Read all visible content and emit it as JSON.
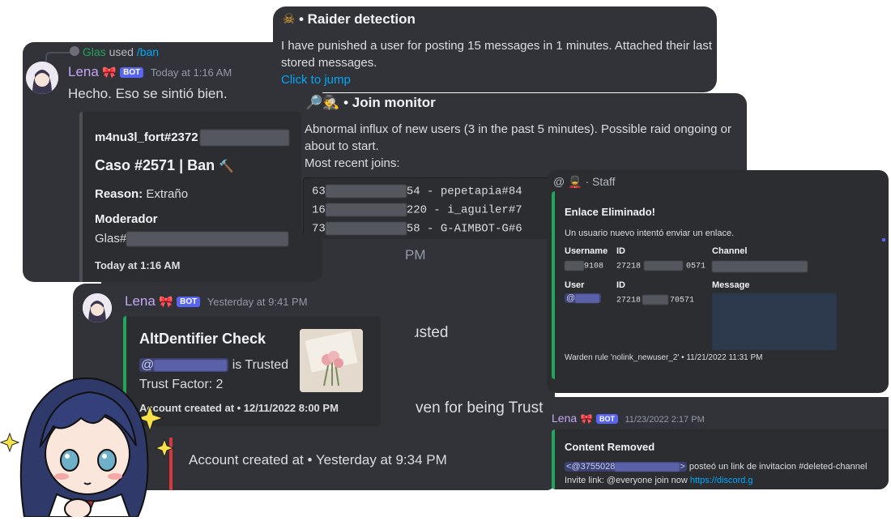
{
  "ban_card": {
    "reply_user": "Glas",
    "reply_used": "used",
    "reply_command": "/ban",
    "author": "Lena",
    "bot_tag": "BOT",
    "timestamp": "Today at 1:16 AM",
    "message": "Hecho. Eso se sintió bien.",
    "embed_user": "m4nu3l_fort#2372",
    "embed_case": "Caso #2571 | Ban",
    "reason_label": "Reason:",
    "reason_value": "Extraño",
    "moderator_label": "Moderador",
    "moderator_value": "Glas#",
    "footer": "Today at 1:16 AM",
    "hammer_icon": "hammer-icon"
  },
  "raider_card": {
    "title": "• Raider detection",
    "text": "I have punished a user for posting 15 messages in 1 minutes. Attached their last stored messages.",
    "link": "Click to jump",
    "icon": "skull-crossbones-icon"
  },
  "join_card": {
    "title": "• Join monitor",
    "text1": "Abnormal influx of new users (3 in the past 5 minutes). Possible raid ongoing or",
    "text2": "about to start.",
    "text3": "Most recent joins:",
    "joins": [
      {
        "prefix": "63",
        "suffix": "54 - pepetapia#84"
      },
      {
        "prefix": "16",
        "suffix": "220 - i_aguiler#7"
      },
      {
        "prefix": "73",
        "suffix": "58 - G-AIMBOT-G#6"
      }
    ],
    "icon": "magnifier-spy-icon"
  },
  "background_fragments": {
    "pm": "PM",
    "usted": "usted",
    "trust": "ven for being Trust",
    "account": "Account created at • Yesterday at 9:34 PM"
  },
  "alt_card": {
    "author": "Lena",
    "bot_tag": "BOT",
    "timestamp": "Yesterday at 9:41 PM",
    "title": "AltDentifier Check",
    "mention_prefix": "@",
    "trusted_text": "is Trusted",
    "trust_factor": "Trust Factor: 2",
    "account_created": "Account created at • 12/11/2022 8:00 PM"
  },
  "staff_card": {
    "channel": "@",
    "channel_name": "· Staff",
    "title": "Enlace Eliminado!",
    "description": "Un usuario nuevo intentó enviar un enlace.",
    "headers": {
      "username": "Username",
      "id": "ID",
      "channel": "Channel",
      "user": "User",
      "id2": "ID",
      "message": "Message"
    },
    "username_value": "9108",
    "id_value_a": "27218",
    "id_value_b": "0571",
    "user_value": "@",
    "id2_value_a": "27218",
    "id2_value_b": "70571",
    "footer": "Warden rule 'nolink_newuser_2' • 11/21/2022 11:31 PM"
  },
  "removed_card": {
    "author": "Lena",
    "bot_tag": "BOT",
    "timestamp": "11/23/2022 2:17 PM",
    "title": "Content Removed",
    "mention": "<@3755028",
    "mention_end": ">",
    "text": "posteó un link de invitacion #deleted-channel",
    "invite_label": "Invite link: @everyone join now",
    "invite_link": "https://discord.g"
  },
  "colors": {
    "discord_bg": "#313338",
    "embed_bg": "#2b2d31",
    "accent_green": "#23a55a",
    "accent_red": "#da373c",
    "link": "#00a8fc",
    "bot_badge": "#5865f2"
  }
}
